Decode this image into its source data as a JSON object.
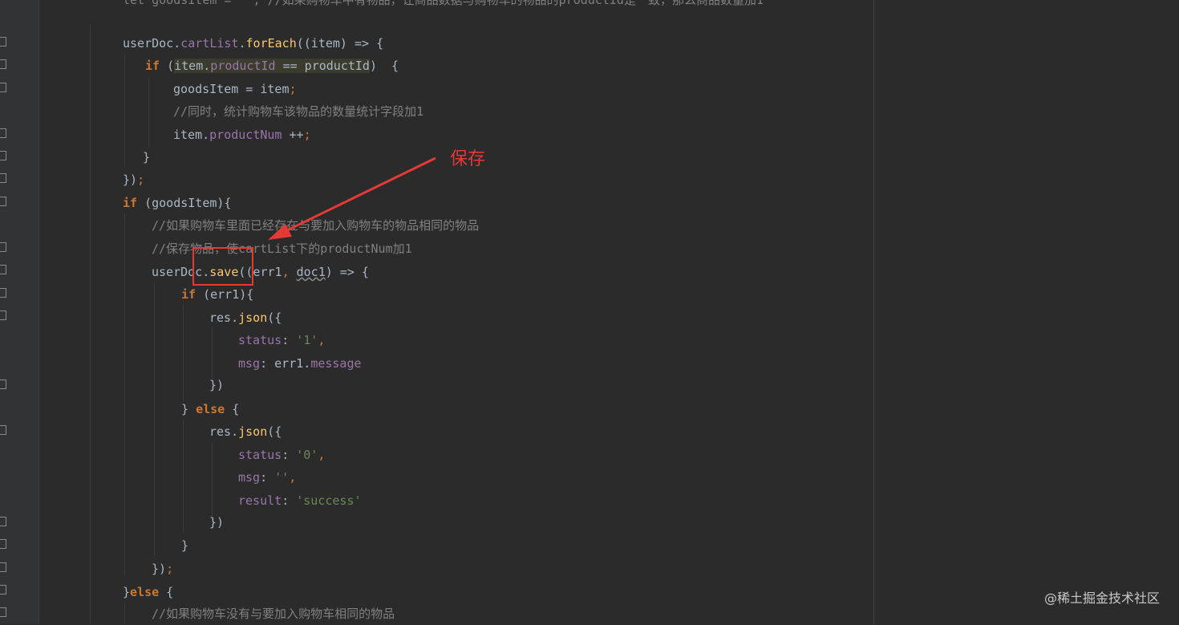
{
  "editor": {
    "top_partial": "let goodsItem = ''; //如果购物车中有物品，让商品数据与购物车的物品的productId是一致，那么商品数量加1",
    "lines": [
      {
        "t": "userDoc.cartList.forEach((item) => {"
      },
      {
        "t": "if (item.productId == productId)  {"
      },
      {
        "t": "goodsItem = item;"
      },
      {
        "t": "//同时，统计购物车该物品的数量统计字段加1"
      },
      {
        "t": "item.productNum ++;"
      },
      {
        "t": "}"
      },
      {
        "t": "});"
      },
      {
        "t": "if (goodsItem){"
      },
      {
        "t": "//如果购物车里面已经存在与要加入购物车的物品相同的物品"
      },
      {
        "t": "//保存物品，使cartList下的productNum加1"
      },
      {
        "t": "userDoc.save((err1, doc1) => {"
      },
      {
        "t": "if (err1){"
      },
      {
        "t": "res.json({"
      },
      {
        "t": "status: '1',"
      },
      {
        "t": "msg: err1.message"
      },
      {
        "t": "})"
      },
      {
        "t": "} else {"
      },
      {
        "t": "res.json({"
      },
      {
        "t": "status: '0',"
      },
      {
        "t": "msg: '',"
      },
      {
        "t": "result: 'success'"
      },
      {
        "t": "})"
      },
      {
        "t": "}"
      },
      {
        "t": "});"
      },
      {
        "t": "}else {"
      },
      {
        "t": "//如果购物车没有与要加入购物车相同的物品"
      }
    ]
  },
  "annotation": {
    "label": "保存",
    "color": "#e53935"
  },
  "watermark": "@稀土掘金技术社区",
  "colors": {
    "background": "#2b2b2b",
    "keyword": "#cc7832",
    "field": "#9876aa",
    "function": "#ffc66d",
    "string": "#6a8759",
    "comment": "#808080",
    "text": "#a9b7c6"
  }
}
